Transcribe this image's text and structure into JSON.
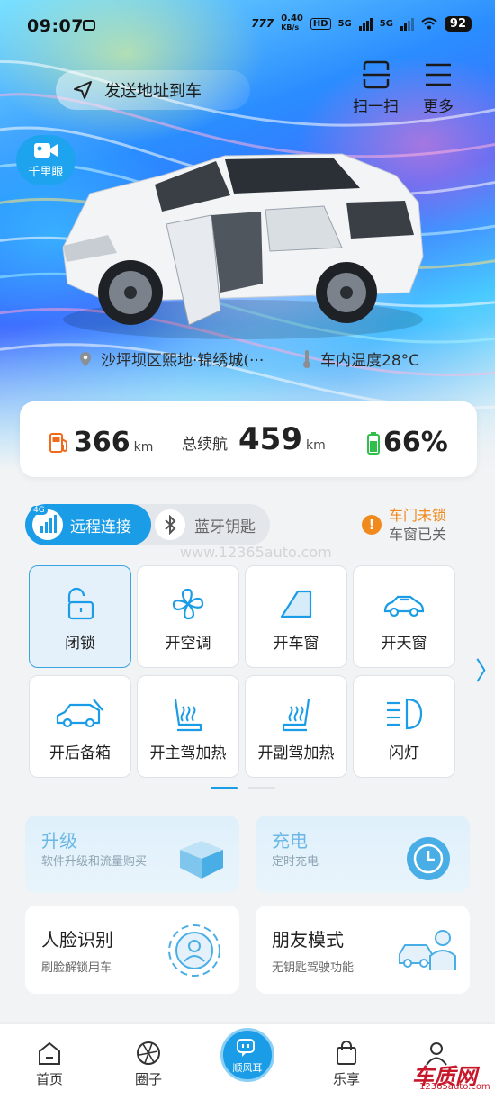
{
  "status_bar": {
    "time": "09:07",
    "net_speed": "0.40",
    "net_unit": "KB/s",
    "hd": "HD",
    "sim1": "5G",
    "sim2": "5G",
    "battery": "92"
  },
  "header": {
    "send_address": "发送地址到车",
    "scan_label": "扫一扫",
    "more_label": "更多",
    "camera_label": "千里眼"
  },
  "vehicle": {
    "location": "沙坪坝区熙地·锦绣城(···",
    "temperature": "车内温度28°C"
  },
  "range": {
    "fuel_value": "366",
    "fuel_unit": "km",
    "total_label": "总续航",
    "total_value": "459",
    "total_unit": "km",
    "battery_value": "66%"
  },
  "connection": {
    "remote_label": "远程连接",
    "remote_badge": "4G",
    "bluetooth_label": "蓝牙钥匙"
  },
  "alerts": {
    "door": "车门未锁",
    "window": "车窗已关"
  },
  "controls": [
    {
      "label": "闭锁",
      "icon": "lock-icon"
    },
    {
      "label": "开空调",
      "icon": "fan-icon"
    },
    {
      "label": "开车窗",
      "icon": "window-icon"
    },
    {
      "label": "开天窗",
      "icon": "sunroof-icon"
    },
    {
      "label": "开后备箱",
      "icon": "trunk-icon"
    },
    {
      "label": "开主驾加热",
      "icon": "seat-heat-icon"
    },
    {
      "label": "开副驾加热",
      "icon": "seat-heat-icon"
    },
    {
      "label": "闪灯",
      "icon": "headlight-icon"
    }
  ],
  "features": {
    "upgrade": {
      "title": "升级",
      "subtitle": "软件升级和流量购买"
    },
    "charge": {
      "title": "充电",
      "subtitle": "定时充电"
    },
    "face": {
      "title": "人脸识别",
      "subtitle": "刷脸解锁用车"
    },
    "friend": {
      "title": "朋友模式",
      "subtitle": "无钥匙驾驶功能"
    }
  },
  "tabs": {
    "home": "首页",
    "circle": "圈子",
    "center": "顺风耳",
    "enjoy": "乐享",
    "me": ""
  },
  "watermark": {
    "center": "www.12365auto.com",
    "brand": "车质网",
    "brand_url": "12365auto.com"
  },
  "colors": {
    "accent": "#1a9ce6",
    "warning": "#f08a1c",
    "fuel": "#f06a1c",
    "battery": "#2fbf4a"
  }
}
